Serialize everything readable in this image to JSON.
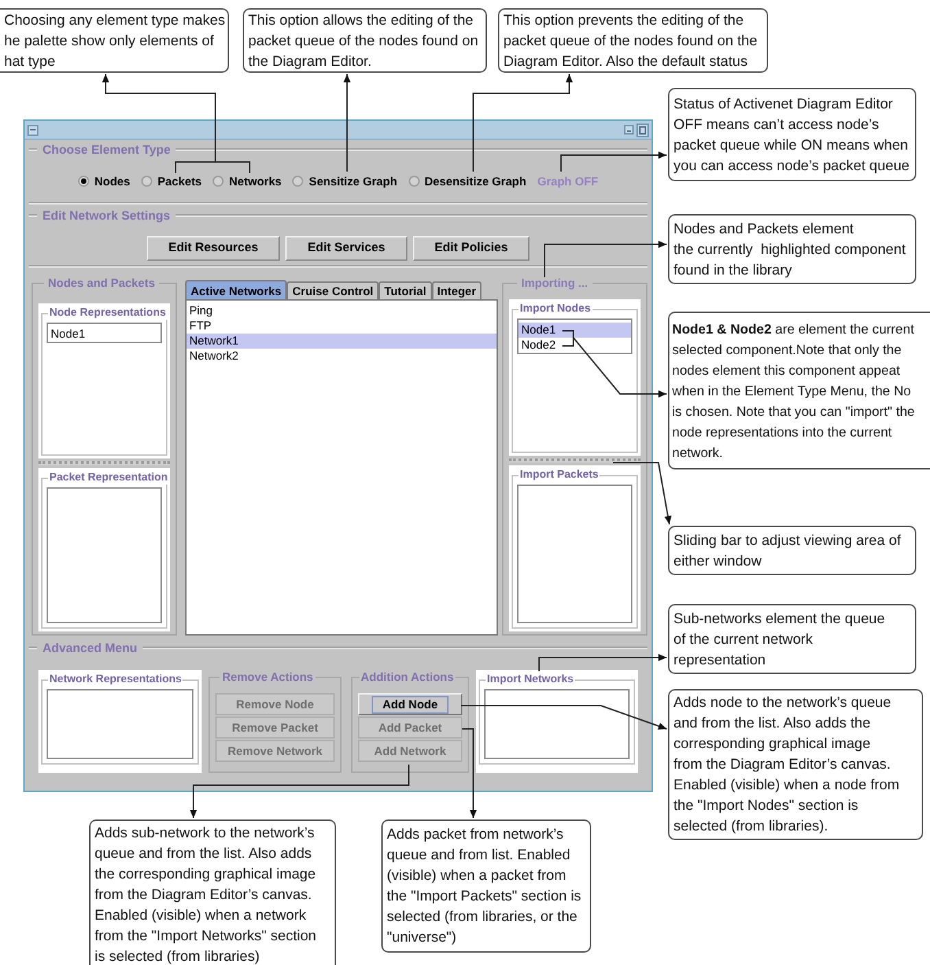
{
  "element_type": {
    "title": "Choose Element Type",
    "options": [
      {
        "label": "Nodes",
        "selected": true
      },
      {
        "label": "Packets",
        "selected": false
      },
      {
        "label": "Networks",
        "selected": false
      },
      {
        "label": "Sensitize Graph",
        "selected": false
      },
      {
        "label": "Desensitize Graph",
        "selected": false
      }
    ],
    "graph_status": "Graph OFF"
  },
  "network_settings": {
    "title": "Edit Network Settings",
    "buttons": [
      "Edit Resources",
      "Edit Services",
      "Edit Policies"
    ]
  },
  "nodes_and_packets": {
    "title": "Nodes and Packets",
    "node_representations": {
      "title": "Node Representations",
      "items": [
        "Node1"
      ]
    },
    "packet_representation": {
      "title": "Packet Representation"
    }
  },
  "network_tabs": [
    {
      "label": "Active Networks",
      "selected": true
    },
    {
      "label": "Cruise Control",
      "selected": false
    },
    {
      "label": "Tutorial",
      "selected": false
    },
    {
      "label": "Integer",
      "selected": false
    }
  ],
  "networks_list": [
    {
      "label": "Ping",
      "selected": false
    },
    {
      "label": "FTP",
      "selected": false
    },
    {
      "label": "Network1",
      "selected": true
    },
    {
      "label": "Network2",
      "selected": false
    }
  ],
  "importing": {
    "title": "Importing ...",
    "import_nodes": {
      "title": "Import Nodes",
      "items": [
        {
          "label": "Node1",
          "selected": true
        },
        {
          "label": "Node2",
          "selected": false
        }
      ]
    },
    "import_packets": {
      "title": "Import Packets"
    }
  },
  "advanced_menu": {
    "title": "Advanced Menu",
    "network_representations": {
      "title": "Network Representations"
    },
    "remove_actions": {
      "title": "Remove Actions",
      "buttons": [
        {
          "label": "Remove Node",
          "disabled": true
        },
        {
          "label": "Remove Packet",
          "disabled": true
        },
        {
          "label": "Remove Network",
          "disabled": true
        }
      ]
    },
    "addition_actions": {
      "title": "Addition Actions",
      "buttons": [
        {
          "label": "Add Node",
          "disabled": false,
          "focused": true
        },
        {
          "label": "Add Packet",
          "disabled": true,
          "focused": false
        },
        {
          "label": "Add Network",
          "disabled": true,
          "focused": false
        }
      ]
    },
    "import_networks": {
      "title": "Import Networks"
    }
  },
  "callouts": [
    {
      "lines": [
        "Choosing any element type makes",
        "he palette show only elements of",
        "hat type"
      ]
    },
    {
      "lines": [
        "This option allows the editing of the",
        "packet queue of the nodes found on",
        "the Diagram Editor."
      ]
    },
    {
      "lines": [
        "This option prevents the editing of the",
        "packet queue of the nodes found on the",
        "Diagram Editor. Also the default status"
      ]
    },
    {
      "lines": [
        "Status of Activenet Diagram Editor",
        "OFF means can’t access node’s",
        "packet queue while ON means when",
        "you can access node’s packet queue"
      ]
    },
    {
      "lines": [
        "Nodes and Packets element",
        "the currently  highlighted component",
        "found in the library"
      ]
    },
    {
      "lines": [
        "**Node1 & Node2** are element the current",
        "selected component.Note that only the",
        "nodes element this component appeat",
        "when in the Element Type Menu, the No",
        "is chosen. Note that you can \"import\" the",
        "node representations into the current",
        "network."
      ]
    },
    {
      "lines": [
        "Sliding bar to adjust viewing area of",
        "either window"
      ]
    },
    {
      "lines": [
        "Sub-networks element the queue",
        "of the current network",
        "representation"
      ]
    },
    {
      "lines": [
        "Adds node to the network’s queue",
        "and from the list. Also adds the",
        "corresponding graphical image",
        "from the Diagram Editor’s canvas.",
        "Enabled (visible) when a node from",
        "the \"Import Nodes\" section is",
        "selected (from libraries)."
      ]
    },
    {
      "lines": [
        "Adds sub-network to the network’s",
        "queue and from the list. Also adds",
        "the corresponding graphical image",
        "from the Diagram Editor’s canvas.",
        "Enabled (visible) when a network",
        "from the \"Import Networks\" section",
        "is selected (from libraries)"
      ]
    },
    {
      "lines": [
        "Adds packet from network’s",
        "queue and from list. Enabled",
        "(visible) when a packet from",
        "the \"Import Packets\" section is",
        "selected (from libraries, or the",
        "\"universe\")"
      ]
    }
  ]
}
